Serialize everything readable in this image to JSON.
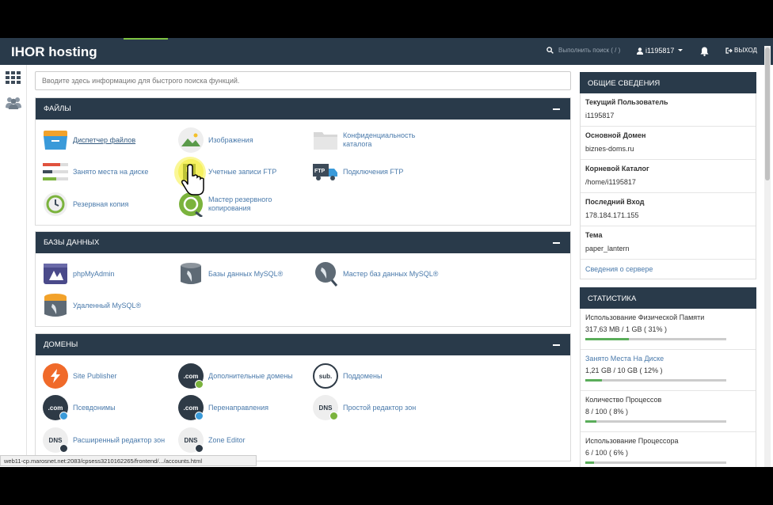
{
  "header": {
    "brand": "IHOR hosting",
    "search_label": "Выполнить поиск ( / )",
    "user": "i1195817",
    "logout": "ВЫХОД"
  },
  "quick_search": {
    "placeholder": "Вводите здесь информацию для быстрого поиска функций."
  },
  "sections": {
    "files": {
      "title": "ФАЙЛЫ",
      "items": [
        "Диспетчер файлов",
        "Изображения",
        "Конфиденциальность каталога",
        "Занято места на диске",
        "Учетные записи FTP",
        "Подключения FTP",
        "Резервная копия",
        "Мастер резервного копирования"
      ]
    },
    "databases": {
      "title": "БАЗЫ ДАННЫХ",
      "items": [
        "phpMyAdmin",
        "Базы данных MySQL®",
        "Мастер баз данных MySQL®",
        "Удаленный MySQL®"
      ]
    },
    "domains": {
      "title": "ДОМЕНЫ",
      "items": [
        "Site Publisher",
        "Дополнительные домены",
        "Поддомены",
        "Псевдонимы",
        "Перенаправления",
        "Простой редактор зон",
        "Расширенный редактор зон",
        "Zone Editor"
      ],
      "icon_text": {
        "com": ".com",
        "sub": "sub.",
        "dns": "DNS"
      }
    }
  },
  "general_info": {
    "title": "ОБЩИЕ СВЕДЕНИЯ",
    "rows": [
      {
        "label": "Текущий Пользователь",
        "value": "i1195817"
      },
      {
        "label": "Основной Домен",
        "value": "biznes-doms.ru"
      },
      {
        "label": "Корневой Каталог",
        "value": "/home/i1195817"
      },
      {
        "label": "Последний Вход",
        "value": "178.184.171.155"
      },
      {
        "label": "Тема",
        "value": "paper_lantern"
      }
    ],
    "server_link": "Сведения о сервере"
  },
  "stats": {
    "title": "СТАТИСТИКА",
    "rows": [
      {
        "label": "Использование Физической Памяти",
        "value": "317,63 MB / 1 GB ( 31% )",
        "percent": 31
      },
      {
        "label": "Занято Места На Диске",
        "value": "1,21 GB / 10 GB ( 12% )",
        "percent": 12
      },
      {
        "label": "Количество Процессов",
        "value": "8 / 100 ( 8% )",
        "percent": 8
      },
      {
        "label": "Использование Процессора",
        "value": "6 / 100 ( 6% )",
        "percent": 6
      }
    ]
  },
  "statusbar": {
    "url": "web11-cp.marosnet.net:2083/cpsess3210162265/frontend/.../accounts.html"
  },
  "colors": {
    "header": "#293a4a",
    "link": "#4a7aab",
    "accent_green": "#7ec242"
  }
}
